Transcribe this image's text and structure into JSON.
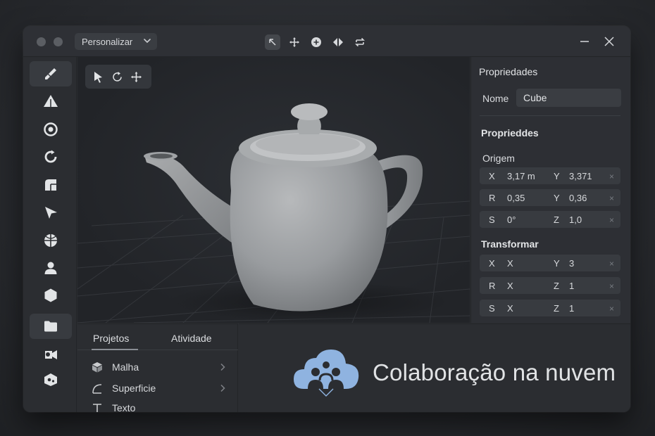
{
  "titlebar": {
    "preset_label": "Personalizar",
    "tools": [
      "arrow-expand-icon",
      "move-icon",
      "add-icon",
      "flip-icon",
      "swap-icon"
    ]
  },
  "rail": {
    "items": [
      {
        "icon": "brush-icon",
        "active": true
      },
      {
        "icon": "triangle-icon",
        "active": false
      },
      {
        "icon": "ring-icon",
        "active": false
      },
      {
        "icon": "refresh-circle-icon",
        "active": false
      },
      {
        "icon": "cube-corner-icon",
        "active": false
      },
      {
        "icon": "cursor-arrow-icon",
        "active": false
      },
      {
        "icon": "sphere-segments-icon",
        "active": false
      },
      {
        "icon": "user-icon",
        "active": false
      },
      {
        "icon": "hexagon-icon",
        "active": false
      },
      {
        "icon": "folder-icon",
        "active": true
      },
      {
        "icon": "camera-icon",
        "active": false
      },
      {
        "icon": "cube-settings-icon",
        "active": false
      }
    ]
  },
  "viewport": {
    "tools": [
      "pointer-icon",
      "rotate-icon",
      "move-icon"
    ]
  },
  "panel": {
    "title": "Propriedades",
    "name_label": "Nome",
    "name_value": "Cube",
    "section_title": "Proprieddes",
    "origin_title": "Origem",
    "origin_rows": [
      {
        "k1": "X",
        "v1": "3,17  m",
        "k2": "Y",
        "v2": "3,371",
        "clear": "×"
      },
      {
        "k1": "R",
        "v1": "0,35",
        "k2": "Y",
        "v2": "0,36",
        "clear": "×"
      },
      {
        "k1": "S",
        "v1": "0°",
        "k2": "Z",
        "v2": "1,0",
        "clear": "×"
      }
    ],
    "transform_title": "Transformar",
    "transform_rows": [
      {
        "k1": "X",
        "v1": "X",
        "k2": "Y",
        "v2": "3",
        "clear": "×"
      },
      {
        "k1": "R",
        "v1": "X",
        "k2": "Z",
        "v2": "1",
        "clear": "×"
      },
      {
        "k1": "S",
        "v1": "X",
        "k2": "Z",
        "v2": "1",
        "clear": "×"
      }
    ]
  },
  "bottom": {
    "tabs": [
      "Projetos",
      "Atividade"
    ],
    "active_tab": "Projetos",
    "items": [
      {
        "icon": "cube-icon",
        "label": "Malha"
      },
      {
        "icon": "curve-icon",
        "label": "Superficie"
      },
      {
        "icon": "text-icon",
        "label": "Texto"
      }
    ],
    "cloud_text": "Colaboração na nuvem"
  },
  "colors": {
    "background": "#26282c",
    "window": "#2b2d31",
    "field": "#383b40",
    "accent_cloud": "#8fb3e0"
  }
}
